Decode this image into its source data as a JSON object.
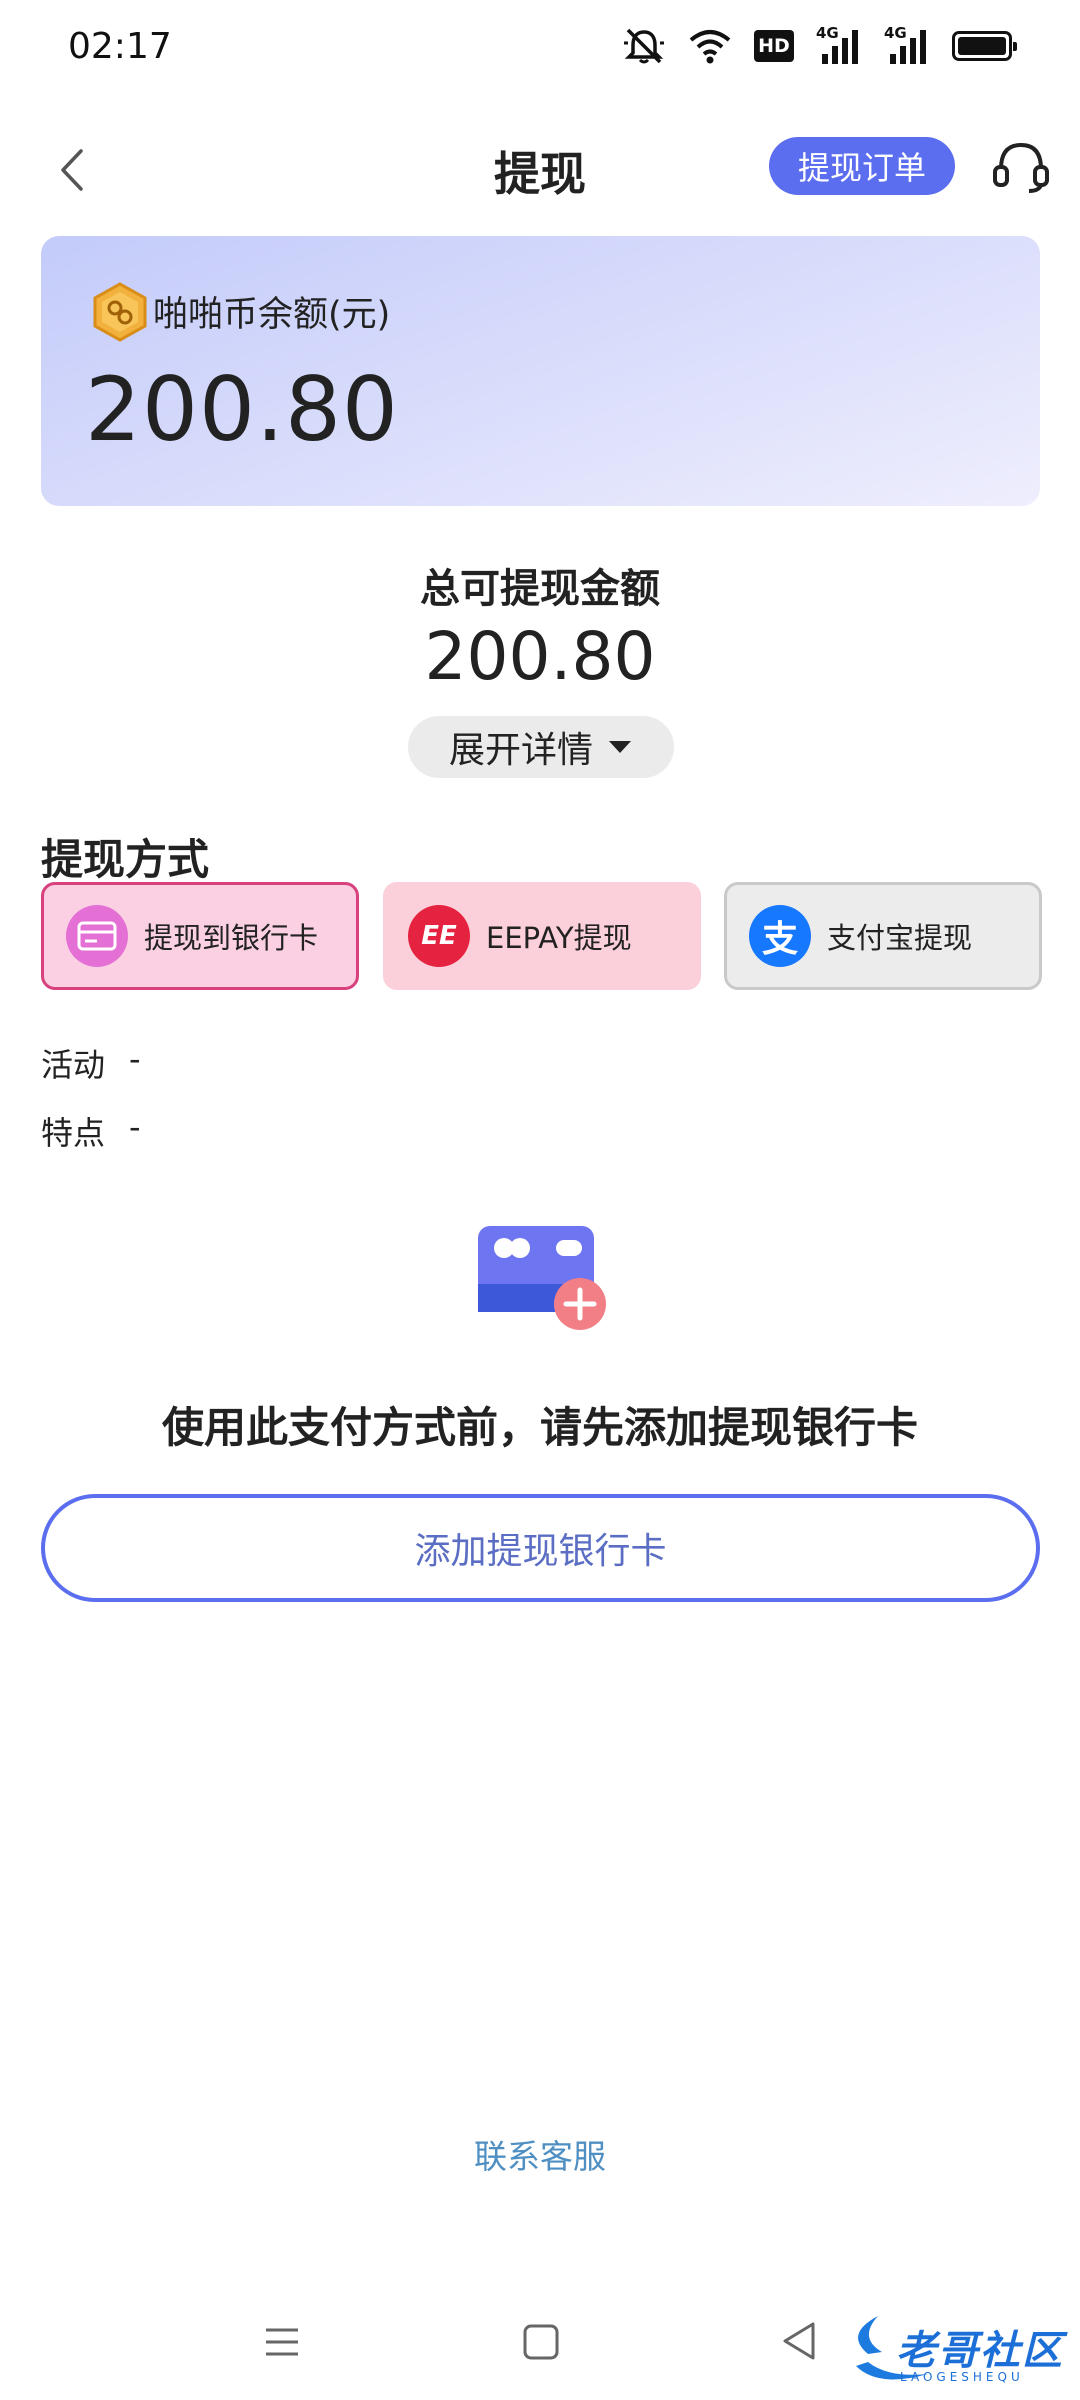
{
  "status_bar": {
    "time": "02:17",
    "icons": [
      "mute-icon",
      "wifi-icon",
      "hd-icon",
      "signal-4g-icon",
      "signal-4g-icon",
      "battery-icon"
    ],
    "hd_label": "HD",
    "network_1": "4G",
    "network_2": "4G"
  },
  "header": {
    "title": "提现",
    "orders_button": "提现订单",
    "back_icon": "chevron-left-icon",
    "service_icon": "headset-icon"
  },
  "balance": {
    "label": "啪啪币余额(元)",
    "value": "200.80",
    "icon": "coin-icon"
  },
  "total": {
    "label": "总可提现金额",
    "value": "200.80",
    "expand_label": "展开详情"
  },
  "methods": {
    "title": "提现方式",
    "items": [
      {
        "label": "提现到银行卡",
        "icon": "bank-card-icon",
        "selected": true
      },
      {
        "label": "EEPAY提现",
        "icon": "eepay-icon",
        "icon_text": "EE",
        "selected": false
      },
      {
        "label": "支付宝提现",
        "icon": "alipay-icon",
        "icon_text": "支",
        "selected": false
      }
    ]
  },
  "info": {
    "activity_label": "活动",
    "activity_value": "-",
    "feature_label": "特点",
    "feature_value": "-"
  },
  "empty_state": {
    "message": "使用此支付方式前，请先添加提现银行卡",
    "button": "添加提现银行卡"
  },
  "footer": {
    "contact": "联系客服"
  },
  "watermark": {
    "text": "老哥社区",
    "subtext": "LAOGESHEQU"
  },
  "colors": {
    "accent": "#5b6ef0",
    "bank_selected_border": "#d8417d",
    "link": "#4f8fc2"
  }
}
